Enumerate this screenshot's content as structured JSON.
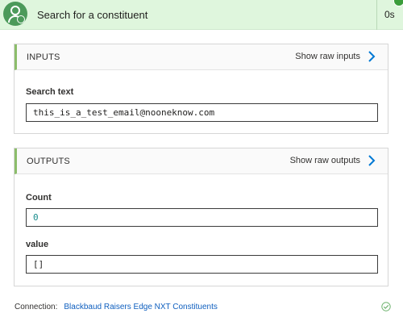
{
  "header": {
    "title": "Search for a constituent",
    "duration": "0s"
  },
  "inputs": {
    "title": "INPUTS",
    "show_raw_label": "Show raw inputs",
    "fields": [
      {
        "label": "Search text",
        "value": "this_is_a_test_email@nooneknow.com"
      }
    ]
  },
  "outputs": {
    "title": "OUTPUTS",
    "show_raw_label": "Show raw outputs",
    "fields": [
      {
        "label": "Count",
        "value": "0"
      },
      {
        "label": "value",
        "value": "[]"
      }
    ]
  },
  "footer": {
    "connection_label": "Connection:",
    "connection_name": "Blackbaud Raisers Edge NXT Constituents"
  },
  "colors": {
    "accent_green": "#4c9a5a",
    "header_bg": "#dff6dd",
    "link_blue": "#0f5fbf",
    "chevron_blue": "#0078d4",
    "count_value_color": "#1a8d8d"
  }
}
